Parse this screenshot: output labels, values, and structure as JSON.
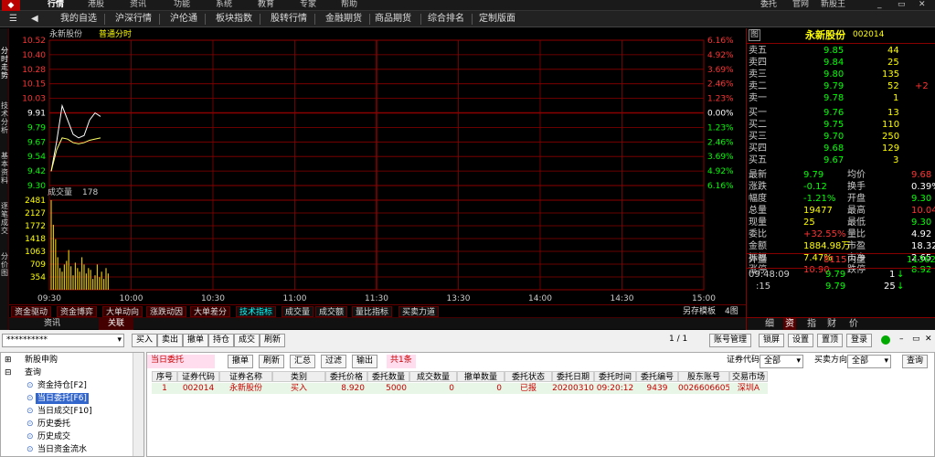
{
  "menu": [
    "行情",
    "港股",
    "资讯",
    "功能",
    "系统",
    "教育",
    "专家",
    "帮助",
    "委托",
    "官网",
    "新股王"
  ],
  "nav": [
    "我的自选",
    "沪深行情",
    "沪伦通",
    "板块指数",
    "股转行情",
    "金融期货",
    "商品期货",
    "综合排名",
    "定制版面"
  ],
  "left_tabs": [
    "分时走势",
    "技术分析",
    "基本资料",
    "逐笔成交",
    "分价图"
  ],
  "chart": {
    "stock_label": "永新股份",
    "period_label": "普通分时",
    "volume_label": "成交量",
    "volume_value": "178",
    "price_ticks": [
      "10.52",
      "10.40",
      "10.28",
      "10.15",
      "10.03",
      "9.91",
      "9.79",
      "9.67",
      "9.54",
      "9.42",
      "9.30"
    ],
    "pct_ticks": [
      "6.16%",
      "4.92%",
      "3.69%",
      "2.46%",
      "1.23%",
      "0.00%",
      "1.23%",
      "2.46%",
      "3.69%",
      "4.92%",
      "6.16%"
    ],
    "vol_ticks": [
      "2481",
      "2127",
      "1772",
      "1418",
      "1063",
      "709",
      "354"
    ],
    "time_ticks": [
      "09:30",
      "10:00",
      "10:30",
      "11:00",
      "11:30",
      "13:30",
      "14:00",
      "14:30",
      "15:00"
    ]
  },
  "chart_data": {
    "type": "line",
    "title": "永新股份 普通分时",
    "price_range": [
      9.3,
      10.52
    ],
    "series": [
      {
        "name": "价格",
        "values": [
          9.42,
          9.67,
          9.97,
          9.85,
          9.73,
          9.7,
          9.72,
          9.85,
          9.91,
          9.88
        ]
      },
      {
        "name": "均价",
        "values": [
          9.42,
          9.6,
          9.7,
          9.69,
          9.66,
          9.65,
          9.66,
          9.68,
          9.69,
          9.7
        ]
      }
    ],
    "volume_series": {
      "name": "成交量",
      "range": [
        0,
        2481
      ],
      "values": [
        2481,
        1800,
        1400,
        900,
        600,
        500,
        700,
        800,
        1100,
        650,
        400,
        750,
        600,
        500,
        900,
        700,
        450,
        600,
        550,
        300,
        400,
        700,
        350,
        500,
        300,
        600,
        450
      ]
    }
  },
  "chart_bar": [
    "资金驱动",
    "资金博弈",
    "大单动向",
    "涨跌动因",
    "大单差分",
    "技术指标",
    "成交量",
    "成交额",
    "量比指标",
    "买卖力道"
  ],
  "chart_bar_right": [
    "另存模板",
    "4图"
  ],
  "subtabs": [
    "资讯",
    "关联"
  ],
  "quote": {
    "header_icon": "图",
    "name": "永新股份",
    "code": "002014",
    "asks": [
      [
        "卖五",
        "9.85",
        "44"
      ],
      [
        "卖四",
        "9.84",
        "25"
      ],
      [
        "卖三",
        "9.80",
        "135"
      ],
      [
        "卖二",
        "9.79",
        "52",
        "+2"
      ],
      [
        "卖一",
        "9.78",
        "1"
      ]
    ],
    "bids": [
      [
        "买一",
        "9.76",
        "13"
      ],
      [
        "买二",
        "9.75",
        "110"
      ],
      [
        "买三",
        "9.70",
        "250"
      ],
      [
        "买四",
        "9.68",
        "129"
      ],
      [
        "买五",
        "9.67",
        "3"
      ]
    ],
    "stats": [
      [
        "最新",
        "9.79",
        "均价",
        "9.68"
      ],
      [
        "涨跌",
        "-0.12",
        "换手",
        "0.39%"
      ],
      [
        "幅度",
        "-1.21%",
        "开盘",
        "9.30"
      ],
      [
        "总量",
        "19477",
        "最高",
        "10.04"
      ],
      [
        "现量",
        "25",
        "最低",
        "9.30"
      ],
      [
        "委比",
        "+32.55%",
        "量比",
        "4.92"
      ],
      [
        "金额",
        "1884.98万",
        "市盈",
        "18.32"
      ],
      [
        "振幅",
        "7.47%",
        "市净",
        "2.65"
      ],
      [
        "涨停",
        "10.90",
        "跌停",
        "8.92"
      ]
    ],
    "outer": [
      "外盘",
      "8115",
      "内盘",
      "11362"
    ],
    "ticks": [
      [
        "09:48:09",
        "9.79",
        "1"
      ],
      [
        ":15",
        "9.79",
        "25"
      ]
    ],
    "bottom_tabs": [
      "细",
      "资",
      "指",
      "财",
      "价"
    ]
  },
  "account": "**********",
  "toolbar": [
    "买入",
    "卖出",
    "撤单",
    "持仓",
    "成交",
    "刷新"
  ],
  "toolbar_right": [
    "1 / 1",
    "账号管理",
    "锁屏",
    "设置",
    "置顶",
    "登录"
  ],
  "tree": [
    "新股申购",
    "查询",
    "资金持仓[F2]",
    "当日委托[F6]",
    "当日成交[F10]",
    "历史委托",
    "历史成交",
    "当日资金流水"
  ],
  "panel": {
    "title": "当日委托",
    "buttons": [
      "撤单",
      "刷新",
      "汇总",
      "过滤",
      "输出"
    ],
    "count": "共1条",
    "code_label": "证券代码",
    "code_value": "全部",
    "dir_label": "买卖方向",
    "dir_value": "全部",
    "query": "查询"
  },
  "table": {
    "headers": [
      "序号",
      "证券代码",
      "证券名称",
      "类别",
      "委托价格",
      "委托数量",
      "成交数量",
      "撤单数量",
      "委托状态",
      "委托日期",
      "委托时间",
      "委托编号",
      "股东账号",
      "交易市场"
    ],
    "row": [
      "1",
      "002014",
      "永新股份",
      "买入",
      "8.920",
      "5000",
      "0",
      "0",
      "已报",
      "20200310",
      "09:20:12",
      "9439",
      "0026606605",
      "深圳A"
    ]
  },
  "colors": {
    "red": "#ff3333",
    "green": "#00ff00",
    "yellow": "#ffff00",
    "white": "#ffffff",
    "grid": "#8b0000",
    "volume": "#e0c000",
    "avgline": "#ffff66",
    "priceline": "#ffffff"
  }
}
